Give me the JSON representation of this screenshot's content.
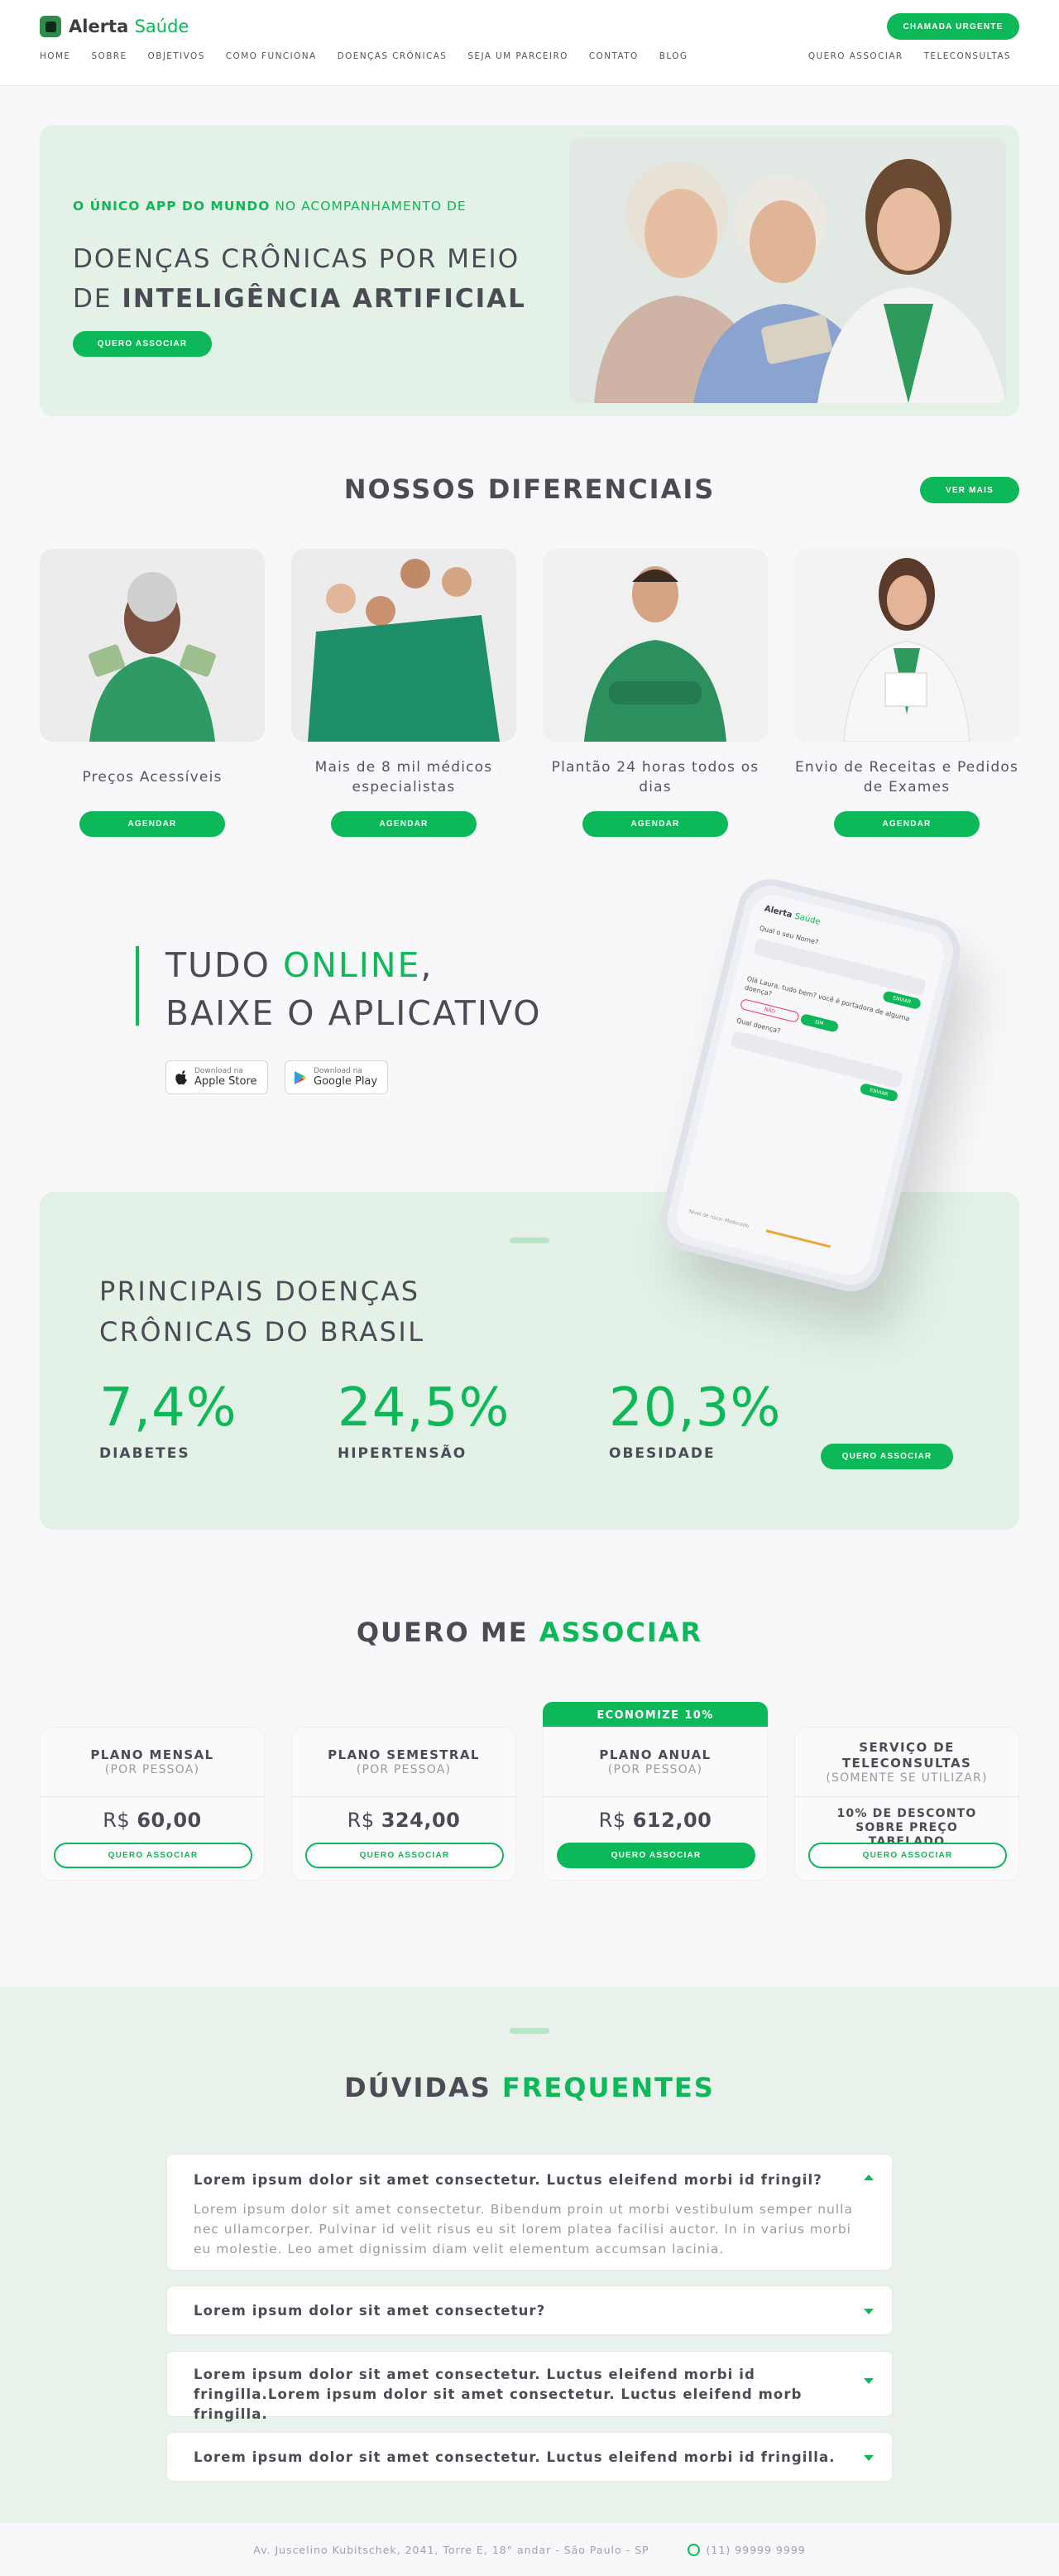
{
  "brand": {
    "name_bold": "Alerta",
    "name_light": "Saúde"
  },
  "header": {
    "urgent_button": "CHAMADA URGENTE",
    "nav": [
      "HOME",
      "SOBRE",
      "OBJETIVOS",
      "COMO FUNCIONA",
      "DOENÇAS CRÔNICAS",
      "SEJA UM PARCEIRO",
      "CONTATO",
      "BLOG"
    ],
    "nav_right": [
      "QUERO ASSOCIAR",
      "TELECONSULTAS"
    ]
  },
  "hero": {
    "kicker_bold": "O ÚNICO APP DO MUNDO",
    "kicker_rest": " NO ACOMPANHAMENTO DE",
    "title_line1": "DOENÇAS CRÔNICAS POR MEIO",
    "title_line2_prefix": "DE ",
    "title_line2_bold": "INTELIGÊNCIA ARTIFICIAL",
    "button": "QUERO ASSOCIAR"
  },
  "diferenciais": {
    "title": "NOSSOS DIFERENCIAIS",
    "ver_mais": "VER MAIS",
    "cards": [
      {
        "label": "Preços Acessíveis",
        "button": "AGENDAR"
      },
      {
        "label": "Mais de 8 mil médicos especialistas",
        "button": "AGENDAR"
      },
      {
        "label": "Plantão 24 horas todos os dias",
        "button": "AGENDAR"
      },
      {
        "label": "Envio de Receitas e Pedidos de Exames",
        "button": "AGENDAR"
      }
    ]
  },
  "online": {
    "line1_prefix": "TUDO ",
    "line1_green": "ONLINE",
    "line1_suffix": ",",
    "line2": "BAIXE O APLICATIVO",
    "apple_small": "Download na",
    "apple_big": "Apple Store",
    "google_small": "Download na",
    "google_big": "Google Play"
  },
  "phone": {
    "q1": "Qual o seu Nome?",
    "send": "ENVIAR",
    "msg": "Olá Laura, tudo bem? você é portadora de alguma doença?",
    "no": "NÃO",
    "yes": "SIM",
    "q2": "Qual doença?",
    "footer": "Nível de risco: Moderado"
  },
  "doencas": {
    "title_line1": "PRINCIPAIS DOENÇAS",
    "title_line2": "CRÔNICAS DO BRASIL",
    "stats": [
      {
        "value": "7,4%",
        "name": "DIABETES"
      },
      {
        "value": "24,5%",
        "name": "HIPERTENSÃO"
      },
      {
        "value": "20,3%",
        "name": "OBESIDADE"
      }
    ],
    "button": "QUERO ASSOCIAR"
  },
  "planos": {
    "title_prefix": "QUERO ME ",
    "title_green": "ASSOCIAR",
    "badge": "ECONOMIZE 10%",
    "items": [
      {
        "name": "PLANO MENSAL",
        "sub": "(POR PESSOA)",
        "currency": "R$",
        "price": "60,00",
        "button": "QUERO ASSOCIAR"
      },
      {
        "name": "PLANO SEMESTRAL",
        "sub": "(POR PESSOA)",
        "currency": "R$",
        "price": "324,00",
        "button": "QUERO ASSOCIAR"
      },
      {
        "name": "PLANO ANUAL",
        "sub": "(POR PESSOA)",
        "currency": "R$",
        "price": "612,00",
        "button": "QUERO ASSOCIAR"
      },
      {
        "name": "SERVIÇO DE TELECONSULTAS",
        "sub": "(SOMENTE SE UTILIZAR)",
        "desc": "10% DE DESCONTO SOBRE PREÇO TABELADO",
        "button": "QUERO ASSOCIAR"
      }
    ]
  },
  "faq": {
    "title_prefix": "DÚVIDAS ",
    "title_green": "FREQUENTES",
    "items": [
      {
        "q": "Lorem ipsum dolor sit amet consectetur. Luctus eleifend morbi id fringil?",
        "a": "Lorem ipsum dolor sit amet consectetur. Bibendum proin ut morbi vestibulum semper nulla nec ullamcorper. Pulvinar id velit risus eu sit lorem platea facilisi auctor. In in varius morbi eu molestie. Leo amet dignissim diam velit elementum accumsan lacinia."
      },
      {
        "q": "Lorem ipsum dolor sit amet consectetur?"
      },
      {
        "q": "Lorem ipsum dolor sit amet consectetur. Luctus eleifend morbi id fringilla.Lorem ipsum dolor sit amet consectetur. Luctus eleifend morb fringilla."
      },
      {
        "q": "Lorem ipsum dolor sit amet consectetur. Luctus eleifend morbi id fringilla."
      }
    ]
  },
  "footer": {
    "address": "Av. Juscelino Kubitschek, 2041, Torre E, 18° andar - São Paulo - SP",
    "phone": "(11) 99999 9999"
  }
}
